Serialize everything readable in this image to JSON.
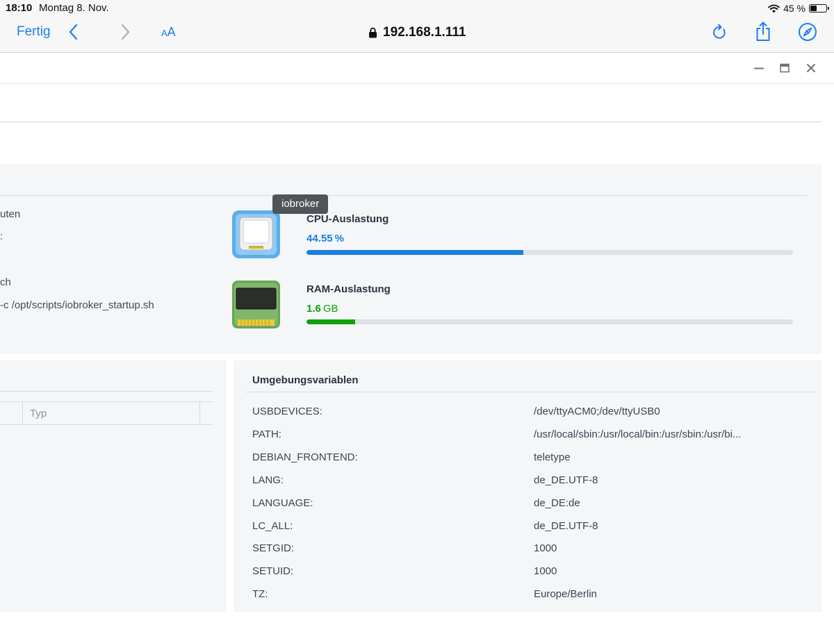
{
  "status_bar": {
    "time": "18:10",
    "date": "Montag 8. Nov.",
    "battery": "45 %",
    "battery_level": 0.45
  },
  "browser": {
    "done_label": "Fertig",
    "text_size_label_small": "A",
    "text_size_label_large": "A",
    "address": "192.168.1.111",
    "icons": [
      "chevron-left-icon",
      "chevron-right-icon",
      "lock-icon",
      "reload-icon",
      "share-icon",
      "compass-icon"
    ]
  },
  "window": {
    "icons": [
      "minimize-icon",
      "maximize-icon",
      "close-icon"
    ]
  },
  "overview": {
    "left_fragments": [
      "uten",
      ":",
      "ch",
      "-c /opt/scripts/iobroker_startup.sh"
    ],
    "tooltip": "iobroker",
    "cpu": {
      "title": "CPU-Auslastung",
      "value": "44.55",
      "unit": "%",
      "percent": 44.55,
      "color": "#1a7fe0"
    },
    "ram": {
      "title": "RAM-Auslastung",
      "value": "1.6",
      "unit": "GB",
      "fill_fraction": 0.1,
      "color": "#0ea30e"
    }
  },
  "ports_table": {
    "column_typ": "Typ"
  },
  "environment": {
    "title": "Umgebungsvariablen",
    "rows": [
      {
        "key": "USBDEVICES:",
        "value": "/dev/ttyACM0;/dev/ttyUSB0"
      },
      {
        "key": "PATH:",
        "value": "/usr/local/sbin:/usr/local/bin:/usr/sbin:/usr/bi..."
      },
      {
        "key": "DEBIAN_FRONTEND:",
        "value": "teletype"
      },
      {
        "key": "LANG:",
        "value": "de_DE.UTF-8"
      },
      {
        "key": "LANGUAGE:",
        "value": "de_DE:de"
      },
      {
        "key": "LC_ALL:",
        "value": "de_DE.UTF-8"
      },
      {
        "key": "SETGID:",
        "value": "1000"
      },
      {
        "key": "SETUID:",
        "value": "1000"
      },
      {
        "key": "TZ:",
        "value": "Europe/Berlin"
      }
    ]
  }
}
